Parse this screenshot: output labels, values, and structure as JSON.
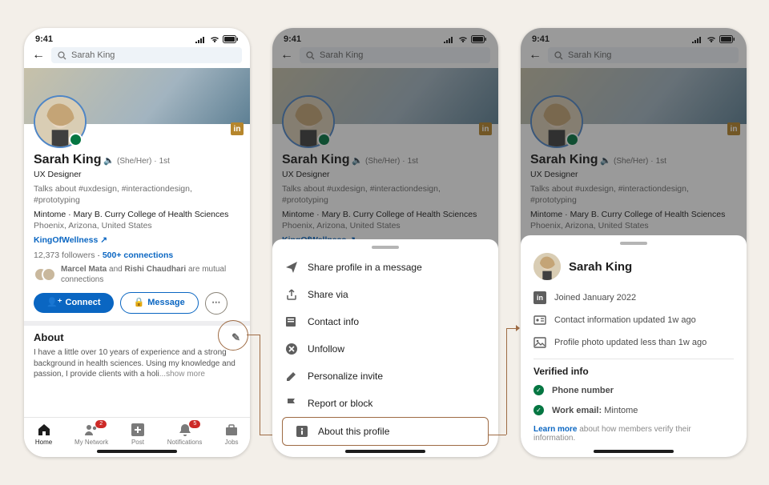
{
  "status": {
    "time": "9:41"
  },
  "search": {
    "value": "Sarah King"
  },
  "profile": {
    "name": "Sarah King",
    "pronouns": "(She/Her)",
    "degree": "1st",
    "headline": "UX Designer",
    "talks": "Talks about #uxdesign, #interactiondesign, #prototyping",
    "org": "Mintome · Mary B. Curry College of Health Sciences",
    "location": "Phoenix, Arizona, United States",
    "website": "KingOfWellness",
    "followers": "12,373 followers",
    "connections": "500+ connections",
    "mutual": "Marcel Mata and Rishi Chaudhari are mutual connections",
    "connect_btn": "Connect",
    "message_btn": "Message",
    "about_h": "About",
    "about_body": "I have a little over 10 years of experience and a strong background in health sciences. Using my knowledge and passion, I provide clients with a holi",
    "show_more": "...show more"
  },
  "nav": {
    "home": "Home",
    "network": "My Network",
    "post": "Post",
    "notif": "Notifications",
    "jobs": "Jobs",
    "network_badge": "2",
    "notif_badge": "5"
  },
  "sheet": {
    "share_msg": "Share profile in a message",
    "share_via": "Share via",
    "contact": "Contact info",
    "unfollow": "Unfollow",
    "personalize": "Personalize invite",
    "report": "Report or block",
    "about": "About this profile"
  },
  "about_profile": {
    "name": "Sarah King",
    "joined": "Joined January 2022",
    "contact_upd": "Contact information updated 1w ago",
    "photo_upd": "Profile photo updated less than 1w ago",
    "verified_h": "Verified info",
    "phone": "Phone number",
    "work_email_label": "Work email:",
    "work_email_value": "Mintome",
    "learn_more": "Learn more",
    "footer_rest": " about how members verify their information."
  }
}
